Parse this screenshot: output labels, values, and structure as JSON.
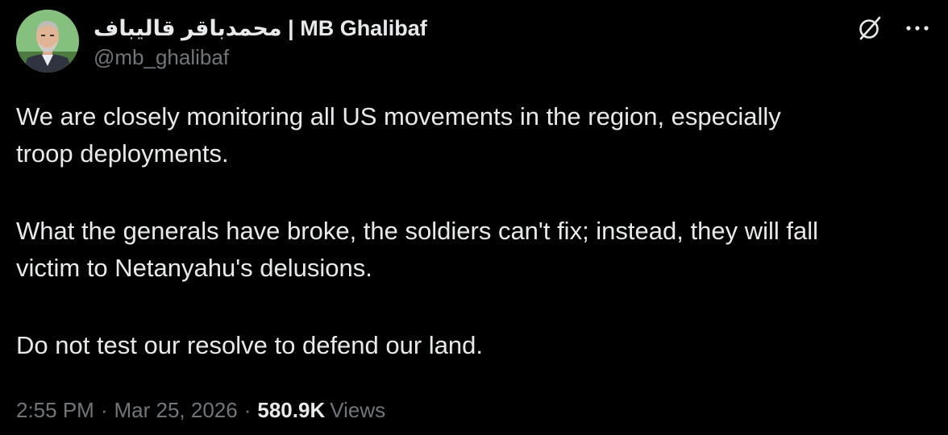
{
  "author": {
    "display_name": "محمدباقر قالیباف | MB Ghalibaf",
    "handle": "@mb_ghalibaf"
  },
  "tweet": {
    "paragraphs": [
      "We are closely monitoring all US movements in the region, especially\ntroop deployments.",
      "What the generals have broke, the soldiers can't fix; instead, they will fall\nvictim to Netanyahu's delusions.",
      "Do not test our resolve to defend our land."
    ]
  },
  "meta": {
    "time": "2:55 PM",
    "separator": "·",
    "date": "Mar 25, 2026",
    "views_count": "580.9K",
    "views_label": "Views"
  },
  "icons": {
    "grok": "grok-icon",
    "more": "more-horizontal-icon"
  },
  "colors": {
    "background": "#000000",
    "primary_text": "#e7e9ea",
    "secondary_text": "#71767b"
  }
}
